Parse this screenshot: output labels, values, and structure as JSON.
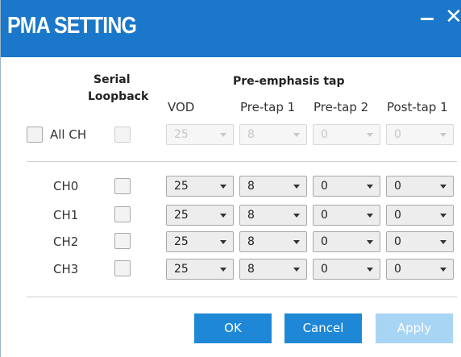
{
  "window": {
    "title": "PMA SETTING",
    "minimize_glyph": "–",
    "close_glyph": "✕",
    "accent_color": "#1a77c9"
  },
  "headers": {
    "serial_loopback_line1": "Serial",
    "serial_loopback_line2": "Loopback",
    "pre_emphasis": "Pre-emphasis tap",
    "vod": "VOD",
    "pre_tap1": "Pre-tap 1",
    "pre_tap2": "Pre-tap 2",
    "post_tap1": "Post-tap 1"
  },
  "all_ch": {
    "label": "All CH",
    "checked": false,
    "loopback_checked": false,
    "enabled": false,
    "vod": "25",
    "pre_tap1": "8",
    "pre_tap2": "0",
    "post_tap1": "0"
  },
  "channels": [
    {
      "label": "CH0",
      "loopback_checked": false,
      "vod": "25",
      "pre_tap1": "8",
      "pre_tap2": "0",
      "post_tap1": "0"
    },
    {
      "label": "CH1",
      "loopback_checked": false,
      "vod": "25",
      "pre_tap1": "8",
      "pre_tap2": "0",
      "post_tap1": "0"
    },
    {
      "label": "CH2",
      "loopback_checked": false,
      "vod": "25",
      "pre_tap1": "8",
      "pre_tap2": "0",
      "post_tap1": "0"
    },
    {
      "label": "CH3",
      "loopback_checked": false,
      "vod": "25",
      "pre_tap1": "8",
      "pre_tap2": "0",
      "post_tap1": "0"
    }
  ],
  "buttons": {
    "ok": "OK",
    "cancel": "Cancel",
    "apply": "Apply",
    "apply_enabled": false
  }
}
